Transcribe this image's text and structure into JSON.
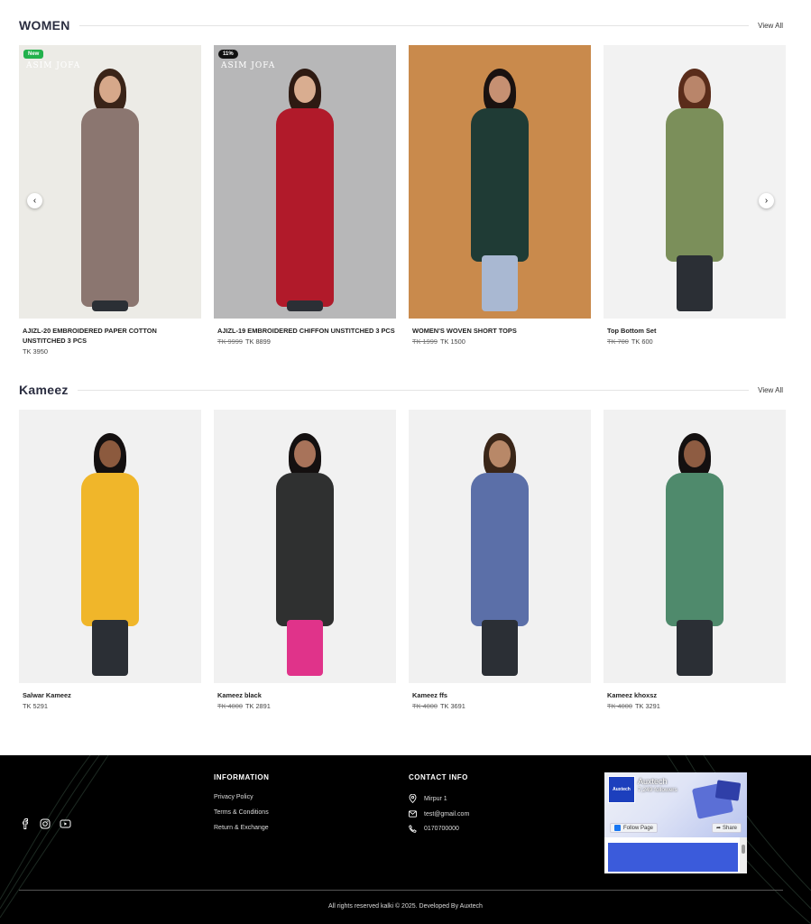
{
  "sections": [
    {
      "title": "WOMEN",
      "view_all": "View All",
      "products": [
        {
          "name": "AJIZL-20 EMBROIDERED PAPER COTTON UNSTITCHED 3 PCS",
          "old_price": "",
          "price": "TK 3950",
          "badge": "New",
          "brand": "ASIM JOFA",
          "bg": "#ecebe6",
          "cloth": "#8b7670",
          "hair": "#3a2418",
          "skin": "#d6a88a"
        },
        {
          "name": "AJIZL-19 EMBROIDERED CHIFFON UNSTITCHED 3 PCS",
          "old_price": "TK 9999",
          "price": "TK 8899",
          "badge": "11%",
          "brand": "ASIM JOFA",
          "bg": "#b7b7b8",
          "cloth": "#b11a2a",
          "hair": "#2e1a12",
          "skin": "#d9ad90"
        },
        {
          "name": "WOMEN'S WOVEN SHORT TOPS",
          "old_price": "TK 1999",
          "price": "TK 1500",
          "badge": "",
          "brand": "",
          "bg": "#c98a4c",
          "cloth": "#1f3b35",
          "hair": "#1a1210",
          "skin": "#c69072"
        },
        {
          "name": "Top Bottom Set",
          "old_price": "TK 700",
          "price": "TK 600",
          "badge": "",
          "brand": "",
          "bg": "#f2f2f2",
          "cloth": "#7b8f5a",
          "hair": "#5a2c1a",
          "skin": "#b9856a"
        }
      ]
    },
    {
      "title": "Kameez",
      "view_all": "View All",
      "products": [
        {
          "name": "Salwar Kameez",
          "old_price": "",
          "price": "TK 5291",
          "badge": "",
          "brand": "",
          "bg": "#f1f1f1",
          "cloth": "#f0b62a",
          "hair": "#141010",
          "skin": "#8c5a3e"
        },
        {
          "name": "Kameez black",
          "old_price": "TK 4000",
          "price": "TK 2891",
          "badge": "",
          "brand": "",
          "bg": "#f1f1f1",
          "cloth": "#2f3030",
          "hair": "#141010",
          "skin": "#a8735a"
        },
        {
          "name": "Kameez ffs",
          "old_price": "TK 4000",
          "price": "TK 3691",
          "badge": "",
          "brand": "",
          "bg": "#f1f1f1",
          "cloth": "#5b6fa8",
          "hair": "#3a2618",
          "skin": "#b88868"
        },
        {
          "name": "Kameez khoxsz",
          "old_price": "TK 4000",
          "price": "TK 3291",
          "badge": "",
          "brand": "",
          "bg": "#f1f1f1",
          "cloth": "#4f8a6c",
          "hair": "#141010",
          "skin": "#8e5c42"
        }
      ]
    }
  ],
  "footer": {
    "information_title": "INFORMATION",
    "info_links": [
      "Privacy Policy",
      "Terms & Conditions",
      "Return & Exchange"
    ],
    "contact_title": "CONTACT INFO",
    "address": "Mirpur 1",
    "email": "test@gmail.com",
    "phone": "0170700000",
    "fb_page_name": "Auxtech",
    "fb_followers": "7,249 followers",
    "fb_follow": "Follow Page",
    "fb_share": "Share",
    "copyright": "All rights reserved kalki © 2025. Developed By Auxtech"
  }
}
